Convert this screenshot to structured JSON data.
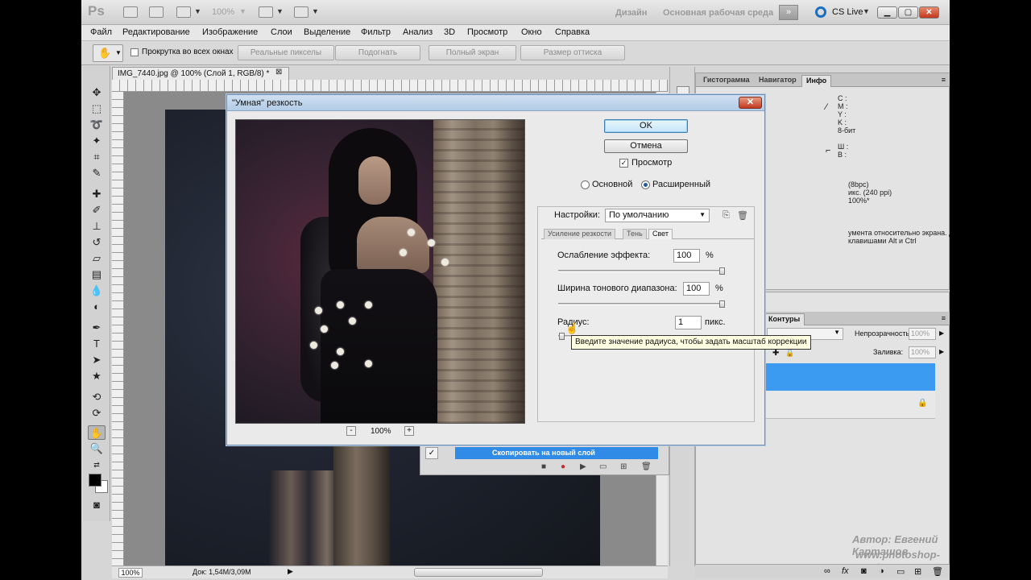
{
  "app": {
    "logo": "Ps",
    "zoom": "100%",
    "workspace_design": "Дизайн",
    "workspace_basic": "Основная рабочая среда",
    "cslive": "CS Live"
  },
  "menu": [
    "Файл",
    "Редактирование",
    "Изображение",
    "Слои",
    "Выделение",
    "Фильтр",
    "Анализ",
    "3D",
    "Просмотр",
    "Окно",
    "Справка"
  ],
  "options": {
    "scroll_all": "Прокрутка во всех окнах",
    "btn_actual": "Реальные пикселы",
    "btn_fit": "Подогнать",
    "btn_full": "Полный экран",
    "btn_print": "Размер оттиска"
  },
  "document": {
    "tab": "IMG_7440.jpg @ 100% (Слой 1, RGB/8) *",
    "close": "⊠",
    "status_zoom": "100%",
    "status_doc": "Док: 1,54M/3,09M"
  },
  "info_panel": {
    "tabs": [
      "Гистограмма",
      "Навигатор",
      "Инфо"
    ],
    "cmyk": "C :\nM :\nY :\nK :\n8-бит",
    "wh": "Ш :\nВ :",
    "bpc": "(8bpc)\nикс. (240 ppi)\n100%*",
    "hint": "умента относительно экрана. Дополнительные\nклавишами Alt и Ctrl"
  },
  "layers_panel": {
    "tab_contours": "Контуры",
    "opacity_label": "Непрозрачность:",
    "opacity_value": "100%",
    "fill_label": "Заливка:",
    "fill_value": "100%"
  },
  "actions_panel": {
    "check": "✓",
    "selected_action": "Скопировать на новый слой"
  },
  "watermark": {
    "author": "Автор: Евгений Карташов",
    "site": "www.photoshop-master.ru"
  },
  "dialog": {
    "title": "\"Умная\" резкость",
    "close": "✕",
    "ok": "OK",
    "cancel": "Отмена",
    "preview_label": "Просмотр",
    "preview_checked": "✓",
    "radio_basic": "Основной",
    "radio_advanced": "Расширенный",
    "settings_label": "Настройки:",
    "settings_value": "По умолчанию",
    "tabs": [
      "Усиление резкости",
      "Тень",
      "Свет"
    ],
    "fade_label": "Ослабление эффекта:",
    "fade_value": "100",
    "fade_unit": "%",
    "tonal_label": "Ширина тонового диапазона:",
    "tonal_value": "100",
    "tonal_unit": "%",
    "radius_label": "Радиус:",
    "radius_value": "1",
    "radius_unit": "пикс.",
    "tooltip": "Введите значение радиуса, чтобы задать масштаб коррекции",
    "zoom_minus": "-",
    "zoom_value": "100%",
    "zoom_plus": "+"
  }
}
